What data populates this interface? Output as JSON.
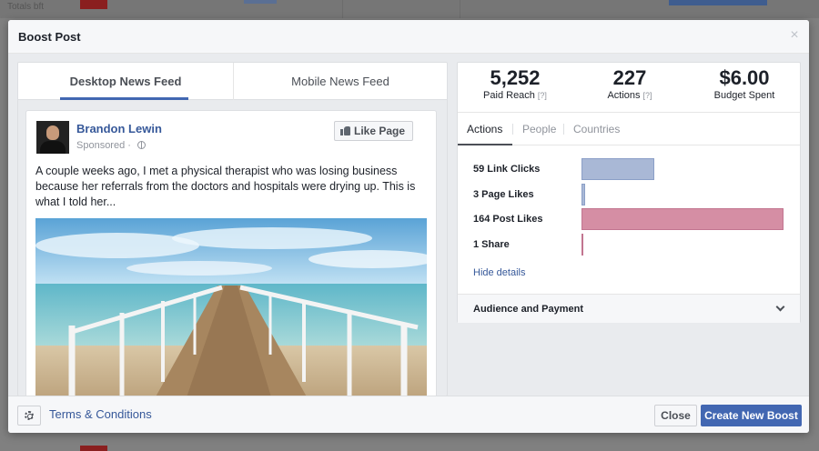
{
  "background": {
    "corner_text": "Totals bft"
  },
  "dialog": {
    "title": "Boost Post",
    "close_glyph": "×"
  },
  "preview": {
    "tabs": [
      {
        "label": "Desktop News Feed",
        "active": true
      },
      {
        "label": "Mobile News Feed",
        "active": false
      }
    ],
    "post": {
      "author": "Brandon Lewin",
      "sponsored_label": "Sponsored · ",
      "like_page_label": "Like Page",
      "text": "A couple weeks ago, I met a physical therapist who was losing business because her referrals from the doctors and hospitals were drying up. This is what I told her..."
    }
  },
  "stats": {
    "metrics": [
      {
        "value": "5,252",
        "label": "Paid Reach",
        "help": "[?]"
      },
      {
        "value": "227",
        "label": "Actions",
        "help": "[?]"
      },
      {
        "value": "$6.00",
        "label": "Budget Spent",
        "help": ""
      }
    ],
    "tabs": [
      {
        "label": "Actions",
        "active": true
      },
      {
        "label": "People",
        "active": false
      },
      {
        "label": "Countries",
        "active": false
      }
    ],
    "actions": [
      {
        "label": "59 Link Clicks",
        "count": 59,
        "color": "#a9b8d6"
      },
      {
        "label": "3 Page Likes",
        "count": 3,
        "color": "#a9b8d6"
      },
      {
        "label": "164 Post Likes",
        "count": 164,
        "color": "#d58ea4"
      },
      {
        "label": "1 Share",
        "count": 1,
        "color": "#d58ea4"
      }
    ],
    "hide_details": "Hide details",
    "audience_label": "Audience and Payment"
  },
  "footer": {
    "terms": "Terms & Conditions",
    "close_label": "Close",
    "create_label": "Create New Boost"
  },
  "colors": {
    "accent": "#4267b2",
    "link": "#365899",
    "bar_blue": "#a9b8d6",
    "bar_pink": "#d58ea4"
  }
}
